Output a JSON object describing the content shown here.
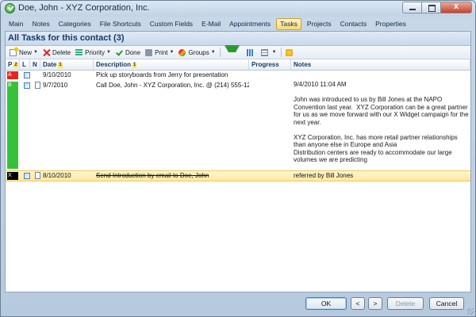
{
  "window": {
    "title": "Doe, John - XYZ Corporation, Inc.",
    "close_glyph": "x"
  },
  "menu": [
    "Main",
    "Notes",
    "Categories",
    "File Shortcuts",
    "Custom Fields",
    "E-Mail",
    "Appointments",
    "Tasks",
    "Projects",
    "Contacts",
    "Properties"
  ],
  "active_menu": "Tasks",
  "header": {
    "title": "All Tasks for this contact (3)"
  },
  "toolbar": {
    "new": "New",
    "delete": "Delete",
    "priority": "Priority",
    "done": "Done",
    "print": "Print",
    "groups": "Groups"
  },
  "columns": {
    "p": "P",
    "p_sort": "2",
    "l": "L",
    "n": "N",
    "date": "Date",
    "date_sort": "1",
    "description": "Description",
    "description_sort": "1",
    "progress": "Progress",
    "notes": "Notes"
  },
  "rows": [
    {
      "priority": "A",
      "priority_color": "#e8231d",
      "date": "9/10/2010",
      "description": "Pick up storyboards from Jerry for presentation",
      "progress": "",
      "notes": ""
    },
    {
      "priority": "B",
      "priority_color": "#36c13b",
      "date": "9/7/2010",
      "description": "Call Doe, John - XYZ Corporation, Inc. @ (214) 555-1234",
      "progress": "",
      "notes": "9/4/2010 11:04 AM\n\nJohn was introduced to us by Bill Jones at the NAPO Convention last year.  XYZ Corporation can be a great partner for us as we move forward with our X Widget campaign for the next year.\n\nXYZ Corporation, Inc. has more retail partner relationships than anyone else in Europe and Asia\nDistribution centers are ready to accommodate our large volumes we are predicting\n\nWe need constant followup to ensure this partnership is one that lasts!"
    },
    {
      "priority": "X",
      "priority_color": "#000000",
      "date": "8/10/2010",
      "description": "Send Introduction by email to Doe, John",
      "progress": "",
      "notes": "referred by Bill Jones"
    }
  ],
  "footer": {
    "ok": "OK",
    "prev": "<",
    "next": ">",
    "delete": "Delete",
    "cancel": "Cancel"
  }
}
